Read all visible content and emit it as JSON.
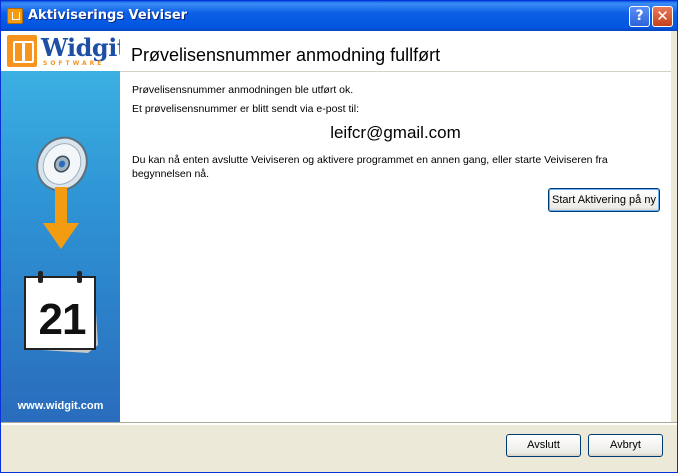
{
  "window": {
    "title": "Aktiviserings Veiviser",
    "help_label": "?",
    "close_label": "✕"
  },
  "sidebar": {
    "logo_text": "Widgit",
    "logo_subtext": "SOFTWARE",
    "calendar_day": "21",
    "website": "www.widgit.com"
  },
  "main": {
    "heading": "Prøvelisensnummer anmodning fullført",
    "line1": "Prøvelisensnummer anmodningen ble utført ok.",
    "line2": "Et prøvelisensnummer er blitt sendt via e-post til:",
    "email": "leifcr@gmail.com",
    "line3a": "Du kan nå enten avslutte Veiviseren og aktivere programmet en annen gang, eller starte Veiviseren fra",
    "line3b": "begynnelsen nå.",
    "restart_label": "Start Aktivering på ny"
  },
  "footer": {
    "finish_label": "Avslutt",
    "cancel_label": "Avbryt"
  },
  "icons": [
    "app-icon",
    "help-icon",
    "close-icon",
    "cd-icon",
    "down-arrow-icon",
    "calendar-icon"
  ],
  "colors": {
    "titlebar": "#0355e0",
    "accent_orange": "#f7941d",
    "sidebar_blue": "#2e93d4"
  }
}
